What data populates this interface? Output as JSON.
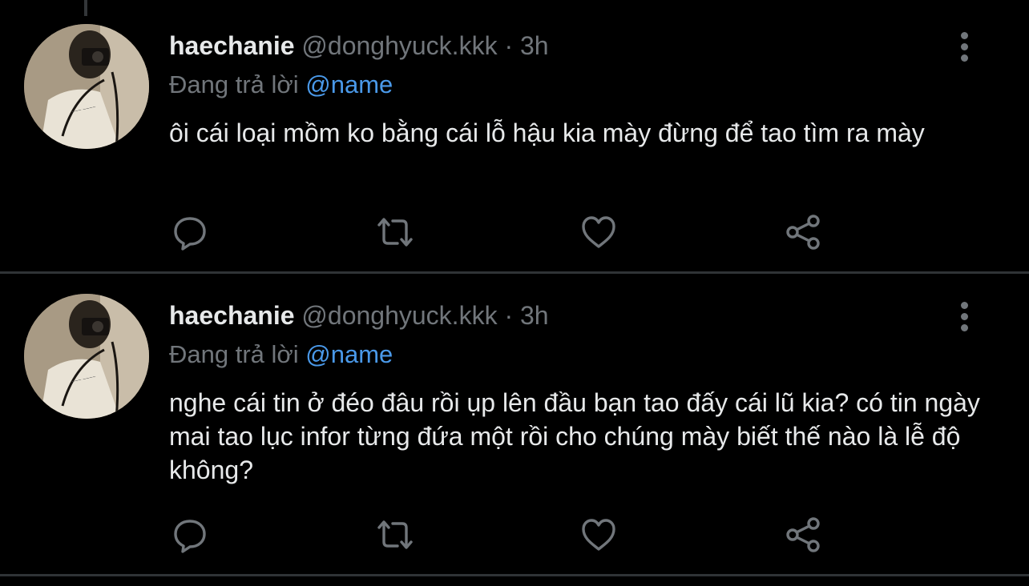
{
  "colors": {
    "background": "#000000",
    "text_primary": "#e7e9ea",
    "text_secondary": "#71767b",
    "mention": "#4a99e9",
    "divider": "#2f3336"
  },
  "tweets": [
    {
      "display_name": "haechanie",
      "handle": "@donghyuck.kkk",
      "separator": "·",
      "time": "3h",
      "reply_prefix": "Đang trả lời",
      "reply_to": "@name",
      "text": "ôi cái loại mồm ko bằng cái lỗ hậu kia mày đừng để tao tìm ra mày",
      "icons": {
        "more": "more-vertical-icon",
        "reply": "reply-icon",
        "retweet": "retweet-icon",
        "like": "heart-icon",
        "share": "share-icon"
      }
    },
    {
      "display_name": "haechanie",
      "handle": "@donghyuck.kkk",
      "separator": "·",
      "time": "3h",
      "reply_prefix": "Đang trả lời",
      "reply_to": "@name",
      "text": "nghe cái tin ở đéo đâu rồi ụp lên đầu bạn tao đấy cái lũ kia? có tin ngày mai tao lục infor từng đứa một rồi cho chúng mày biết thế nào là lễ độ không?",
      "icons": {
        "more": "more-vertical-icon",
        "reply": "reply-icon",
        "retweet": "retweet-icon",
        "like": "heart-icon",
        "share": "share-icon"
      }
    }
  ]
}
